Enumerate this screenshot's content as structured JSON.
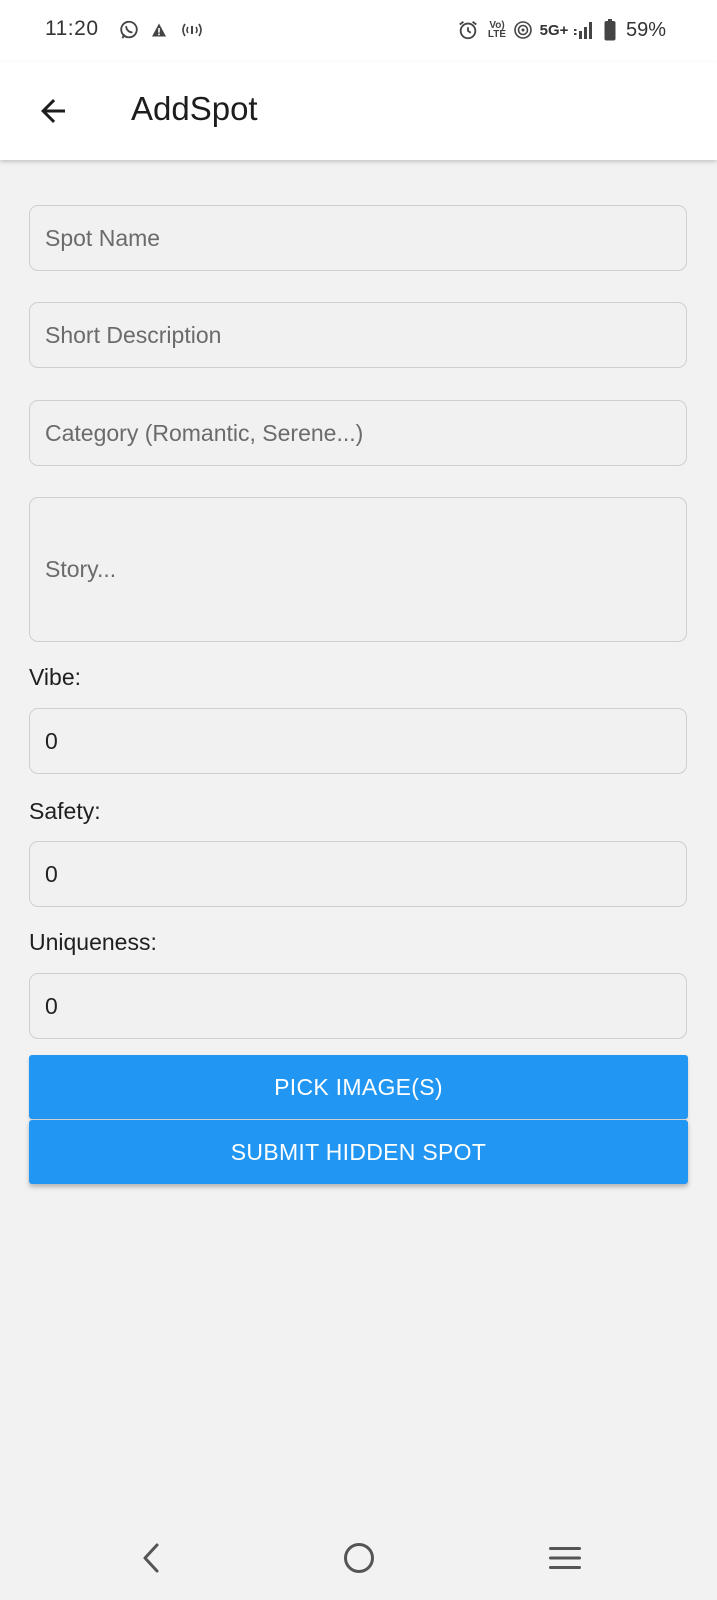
{
  "status_bar": {
    "time": "11:20",
    "left_icons": [
      "whatsapp-icon",
      "warning-icon",
      "hotspot-icon"
    ],
    "right_icons": [
      "alarm-icon",
      "volte-icon",
      "wifi-calling-icon",
      "signal-icon",
      "battery-icon"
    ],
    "network": "5G+",
    "volte_top": "Vo)",
    "volte_bottom": "LTE",
    "battery": "59%"
  },
  "app_bar": {
    "back_icon": "arrow-left-icon",
    "title": "AddSpot"
  },
  "form": {
    "spot_name_placeholder": "Spot Name",
    "short_description_placeholder": "Short Description",
    "category_placeholder": "Category (Romantic, Serene...)",
    "story_placeholder": "Story...",
    "vibe_label": "Vibe:",
    "vibe_value": "0",
    "safety_label": "Safety:",
    "safety_value": "0",
    "uniqueness_label": "Uniqueness:",
    "uniqueness_value": "0"
  },
  "buttons": {
    "pick_images": "PICK IMAGE(S)",
    "submit": "SUBMIT HIDDEN SPOT"
  },
  "nav_bar": {
    "icons": [
      "nav-back-icon",
      "nav-home-icon",
      "nav-recents-icon"
    ]
  },
  "colors": {
    "accent": "#2196f3",
    "background": "#f2f2f2",
    "app_bar": "#ffffff"
  }
}
